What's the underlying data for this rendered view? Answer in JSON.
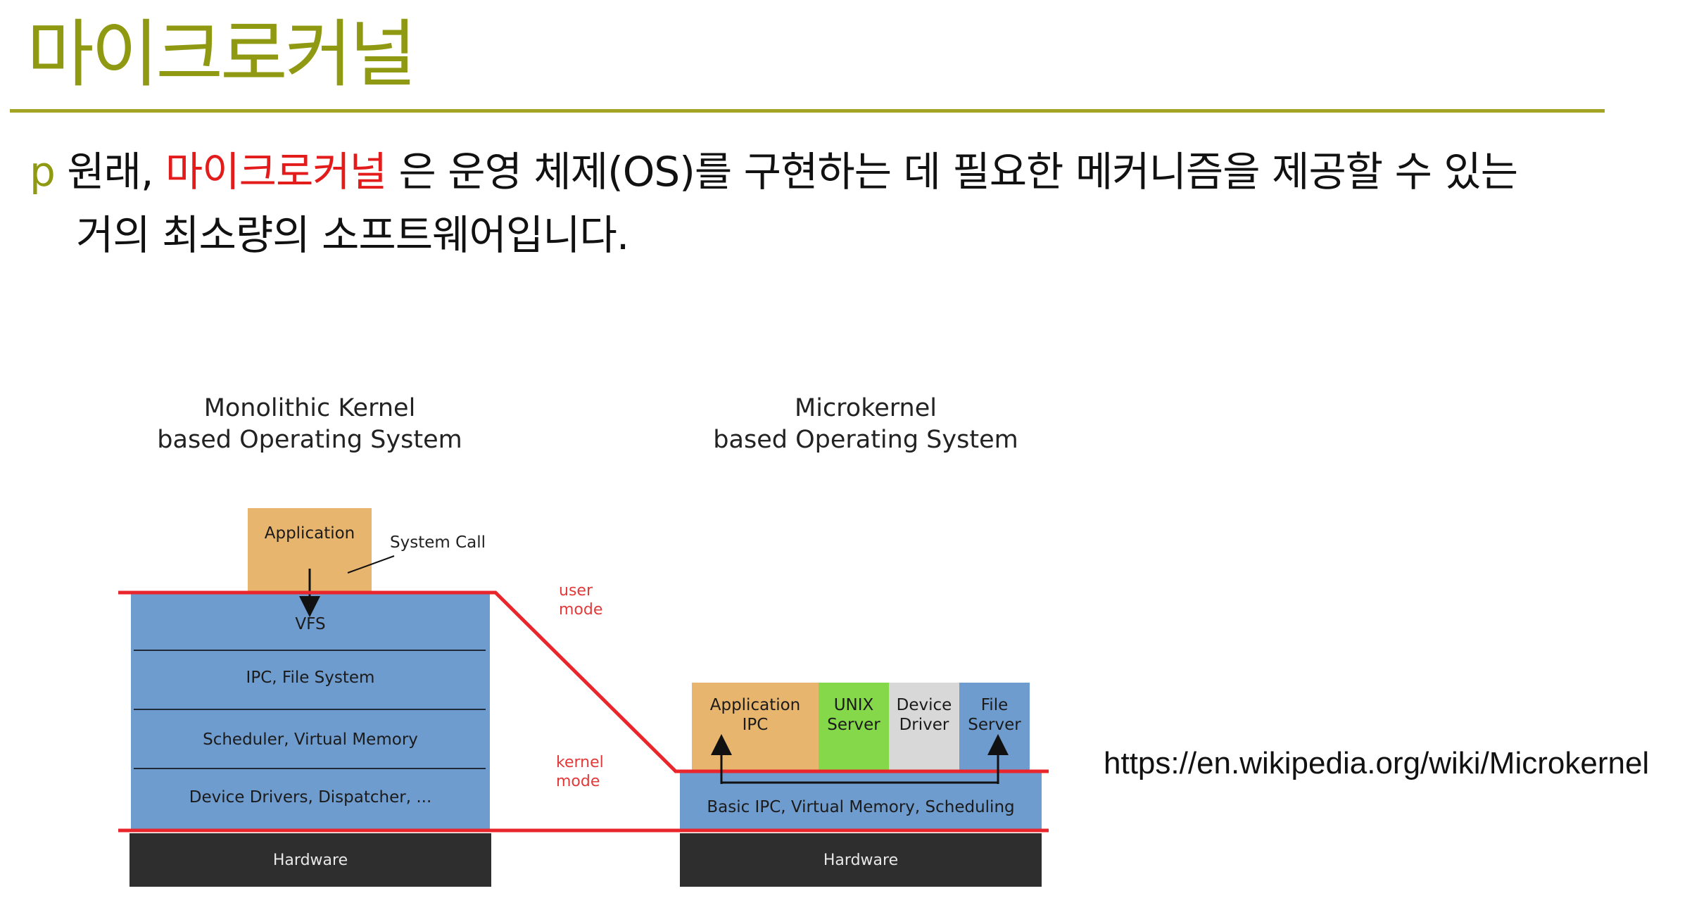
{
  "slide": {
    "title": "마이크로커널",
    "bullet": {
      "marker": "p",
      "before": "원래, ",
      "highlight": "마이크로커널",
      "after": " 은 운영 체제(OS)를 구현하는 데 필요한 메커니즘을 제공할 수 있는",
      "line2": "거의 최소량의 소프트웨어입니다."
    },
    "source_url": "https://en.wikipedia.org/wiki/Microkernel",
    "colors": {
      "title": "#8f9a12",
      "highlight": "#e31b1b",
      "mode_line": "#e8262b"
    }
  },
  "diagram": {
    "monolithic": {
      "heading_line1": "Monolithic Kernel",
      "heading_line2": "based Operating System",
      "application": "Application",
      "system_call": "System Call",
      "layers": [
        "VFS",
        "IPC, File System",
        "Scheduler, Virtual Memory",
        "Device Drivers, Dispatcher, ..."
      ],
      "hardware": "Hardware"
    },
    "microkernel": {
      "heading_line1": "Microkernel",
      "heading_line2": "based Operating System",
      "servers": [
        {
          "line1": "Application",
          "line2": "IPC"
        },
        {
          "line1": "UNIX",
          "line2": "Server"
        },
        {
          "line1": "Device",
          "line2": "Driver"
        },
        {
          "line1": "File",
          "line2": "Server"
        }
      ],
      "kernel": "Basic IPC, Virtual Memory, Scheduling",
      "hardware": "Hardware"
    },
    "modes": {
      "user_line1": "user",
      "user_line2": "mode",
      "kernel_line1": "kernel",
      "kernel_line2": "mode"
    }
  }
}
